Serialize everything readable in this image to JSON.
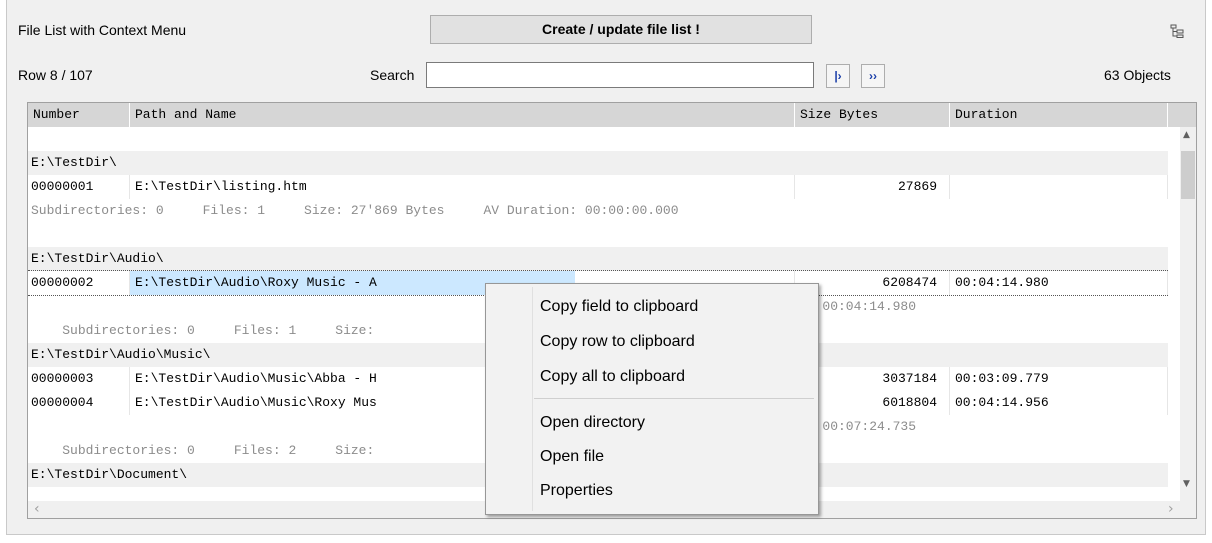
{
  "header": {
    "title": "File List with Context Menu",
    "create_button": "Create / update file list !",
    "row_position": "Row 8 / 107",
    "search_label": "Search",
    "search_value": "",
    "find_next": "|›",
    "find_all": "››",
    "object_count": "63 Objects"
  },
  "table": {
    "columns": [
      "Number",
      "Path and Name",
      "Size Bytes",
      "Duration"
    ],
    "rows": [
      {
        "type": "dir",
        "path": "E:\\TestDir\\"
      },
      {
        "type": "file",
        "number": "00000001",
        "path": "E:\\TestDir\\listing.htm",
        "size": "27869",
        "duration": ""
      },
      {
        "type": "summary",
        "text": "Subdirectories: 0     Files: 1     Size: 27'869 Bytes     AV Duration: 00:00:00.000"
      },
      {
        "type": "dir",
        "path": "E:\\TestDir\\Audio\\"
      },
      {
        "type": "file",
        "number": "00000002",
        "path": "E:\\TestDir\\Audio\\Roxy Music - A",
        "size": "6208474",
        "duration": "00:04:14.980"
      },
      {
        "type": "summary",
        "text": "Subdirectories: 0     Files: 1     Size:",
        "tail": "n: 00:04:14.980"
      },
      {
        "type": "dir",
        "path": "E:\\TestDir\\Audio\\Music\\"
      },
      {
        "type": "file",
        "number": "00000003",
        "path": "E:\\TestDir\\Audio\\Music\\Abba - H",
        "size": "3037184",
        "duration": "00:03:09.779"
      },
      {
        "type": "file",
        "number": "00000004",
        "path": "E:\\TestDir\\Audio\\Music\\Roxy Mus",
        "size": "6018804",
        "duration": "00:04:14.956"
      },
      {
        "type": "summary",
        "text": "Subdirectories: 0     Files: 2     Size:",
        "tail": "n: 00:07:24.735"
      },
      {
        "type": "dir",
        "path": "E:\\TestDir\\Document\\"
      }
    ]
  },
  "context_menu": {
    "items": [
      "Copy field to clipboard",
      "Copy row to clipboard",
      "Copy all to clipboard",
      "Open directory",
      "Open file",
      "Properties"
    ]
  },
  "icons": {
    "scroll_up": "▲",
    "scroll_down": "▼",
    "scroll_left": "‹",
    "scroll_right": "›"
  }
}
